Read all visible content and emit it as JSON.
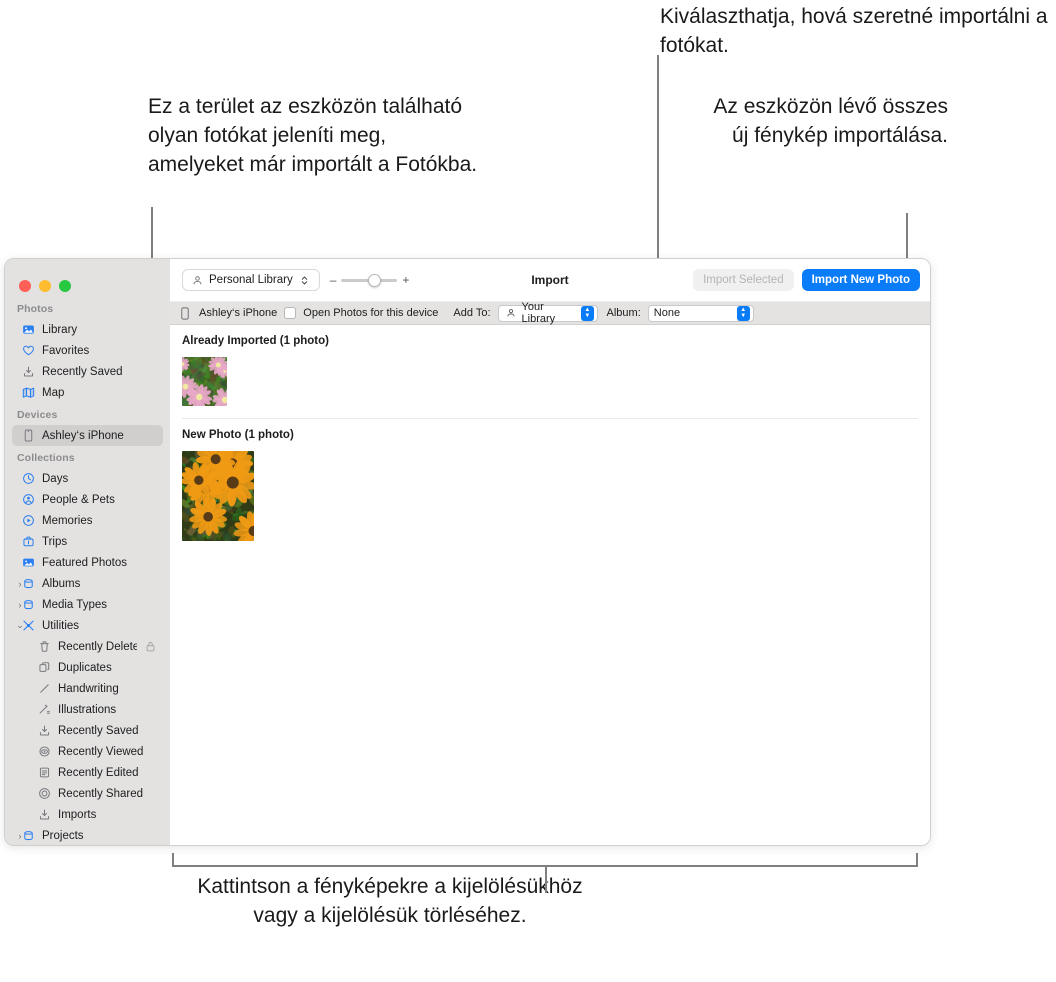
{
  "callouts": {
    "left": "Ez a terület az eszközön található olyan fotókat jeleníti meg, amelyeket már importált a Fotókba.",
    "top": "Kiválaszthatja, hová szeretné importálni a fotókat.",
    "right": "Az eszközön lévő összes új fénykép importálása.",
    "bottom": "Kattintson a fényképekre a kijelölésükhöz vagy a kijelölésük törléséhez."
  },
  "window": {
    "traffic_lights": [
      "close-button",
      "minimize-button",
      "zoom-button"
    ],
    "toolbar": {
      "library_popup": "Personal Library",
      "zoom_minus": "–",
      "zoom_plus": "+",
      "title": "Import",
      "import_selected_label": "Import Selected",
      "import_new_photo_label": "Import New Photo",
      "accent_color": "#0a7cf7",
      "disabled_color": "#b4b4b4"
    },
    "subbar": {
      "device_name": "Ashley‘s iPhone",
      "open_photos_label": "Open Photos for this device",
      "open_photos_checked": false,
      "add_to_label": "Add To:",
      "add_to_value": "Your Library",
      "album_label": "Album:",
      "album_value": "None"
    },
    "sidebar": {
      "groups": [
        {
          "title": "Photos",
          "items": [
            {
              "label": "Library",
              "icon": "library-icon",
              "selected": false
            },
            {
              "label": "Favorites",
              "icon": "heart-icon",
              "selected": false
            },
            {
              "label": "Recently Saved",
              "icon": "save-icon",
              "selected": false
            },
            {
              "label": "Map",
              "icon": "map-icon",
              "selected": false
            }
          ]
        },
        {
          "title": "Devices",
          "items": [
            {
              "label": "Ashley‘s iPhone",
              "icon": "iphone-icon",
              "selected": true
            }
          ]
        },
        {
          "title": "Collections",
          "items": [
            {
              "label": "Days",
              "icon": "clock-icon",
              "selected": false
            },
            {
              "label": "People & Pets",
              "icon": "person-icon",
              "selected": false
            },
            {
              "label": "Memories",
              "icon": "memories-icon",
              "selected": false
            },
            {
              "label": "Trips",
              "icon": "suitcase-icon",
              "selected": false
            },
            {
              "label": "Featured Photos",
              "icon": "featured-photo-icon",
              "selected": false
            },
            {
              "label": "Albums",
              "icon": "album-folder-icon",
              "selected": false,
              "disclosure": "collapsed"
            },
            {
              "label": "Media Types",
              "icon": "album-folder-icon",
              "selected": false,
              "disclosure": "collapsed"
            },
            {
              "label": "Utilities",
              "icon": "tools-icon",
              "selected": false,
              "disclosure": "expanded"
            },
            {
              "label": "Recently Deleted",
              "icon": "trash-icon",
              "selected": false,
              "indent": true,
              "trailing": "lock-icon"
            },
            {
              "label": "Duplicates",
              "icon": "duplicates-icon",
              "selected": false,
              "indent": true
            },
            {
              "label": "Handwriting",
              "icon": "pen-icon",
              "selected": false,
              "indent": true
            },
            {
              "label": "Illustrations",
              "icon": "illustrations-icon",
              "selected": false,
              "indent": true
            },
            {
              "label": "Recently Saved",
              "icon": "save-icon",
              "selected": false,
              "indent": true
            },
            {
              "label": "Recently Viewed",
              "icon": "eye-target-icon",
              "selected": false,
              "indent": true
            },
            {
              "label": "Recently Edited",
              "icon": "edited-icon",
              "selected": false,
              "indent": true
            },
            {
              "label": "Recently Shared",
              "icon": "shared-icon",
              "selected": false,
              "indent": true
            },
            {
              "label": "Imports",
              "icon": "save-icon",
              "selected": false,
              "indent": true
            },
            {
              "label": "Projects",
              "icon": "album-folder-icon",
              "selected": false,
              "disclosure": "collapsed"
            }
          ]
        }
      ]
    },
    "photo_area": {
      "sections": [
        {
          "heading": "Already Imported (1 photo)",
          "photos": [
            {
              "alt": "pink-flowers-thumbnail"
            }
          ]
        },
        {
          "heading": "New Photo (1 photo)",
          "photos": [
            {
              "alt": "orange-rudbeckia-flowers-thumbnail"
            }
          ]
        }
      ]
    }
  }
}
